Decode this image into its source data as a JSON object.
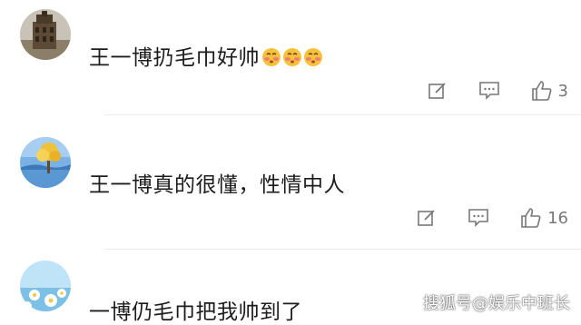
{
  "comments": [
    {
      "text": "王一博扔毛巾好帅",
      "emoji_icons": [
        "blushing-face-icon",
        "blushing-face-icon",
        "blushing-face-icon"
      ],
      "likes": "3"
    },
    {
      "text": "王一博真的很懂，性情中人",
      "likes": "16"
    },
    {
      "text": "一博仍毛巾把我帅到了"
    }
  ],
  "watermark": "搜狐号@娱乐中班长",
  "colors": {
    "text": "#1c1c1c",
    "icon_gray": "#777777",
    "divider": "#ececec"
  }
}
